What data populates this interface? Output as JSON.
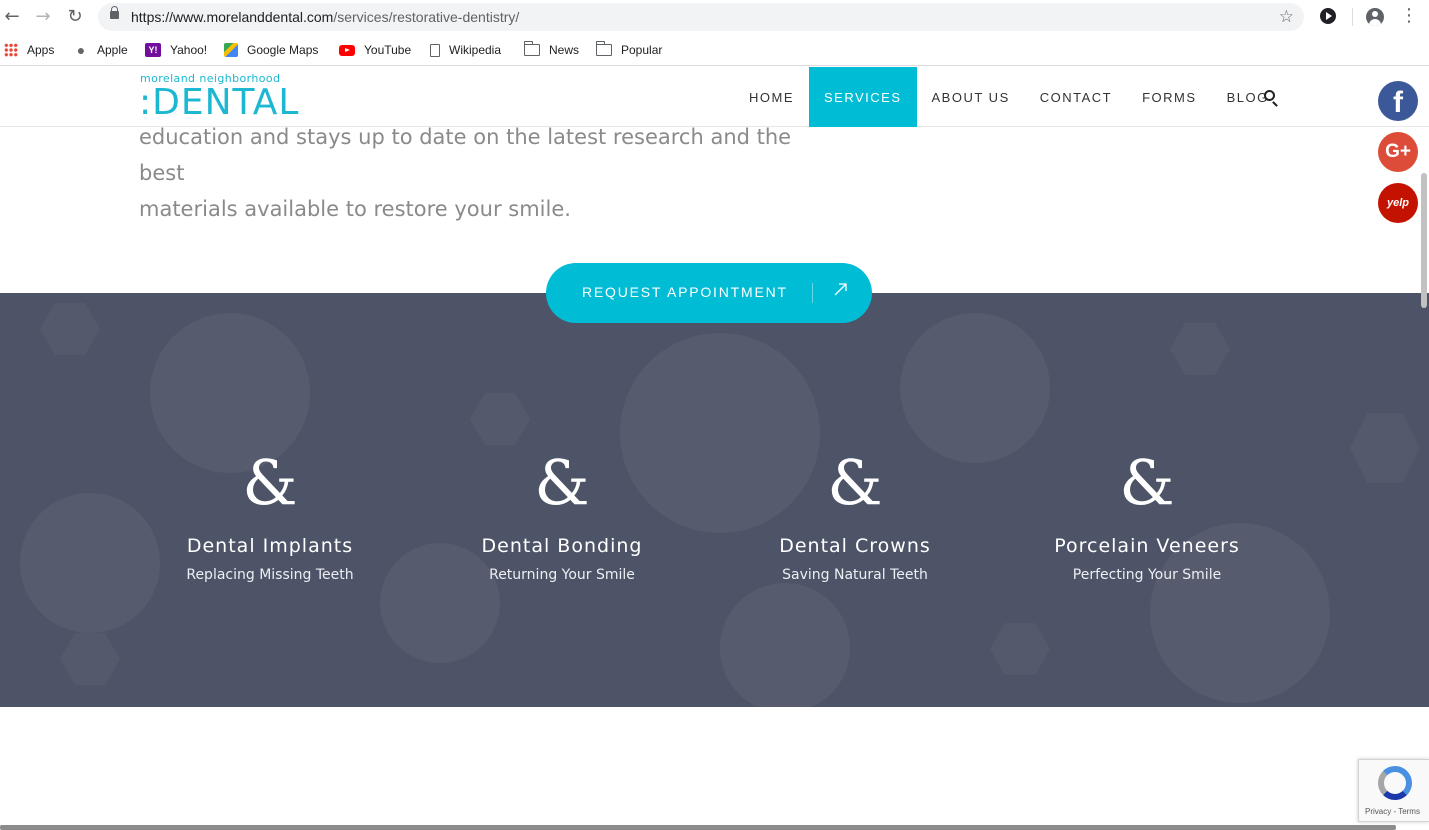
{
  "browser": {
    "url_host": "https://www.morelanddental.com",
    "url_path": "/services/restorative-dentistry/",
    "bookmarks": [
      "Apps",
      "Apple",
      "Yahoo!",
      "Google Maps",
      "YouTube",
      "Wikipedia",
      "News",
      "Popular"
    ]
  },
  "site": {
    "logo_top": "moreland neighborhood",
    "logo_main": ":DENTAL",
    "menu": [
      "HOME",
      "SERVICES",
      "ABOUT US",
      "CONTACT",
      "FORMS",
      "BLOG"
    ],
    "active_menu": "SERVICES",
    "accent_color": "#00bcd4",
    "dark_section_color": "#4d5467"
  },
  "social": {
    "facebook": "f",
    "google_plus": "G+",
    "yelp": "yelp"
  },
  "intro": {
    "line1": "education and stays up to date on the latest research and the best",
    "line2": "materials available to restore your smile."
  },
  "cta": {
    "label": "REQUEST APPOINTMENT"
  },
  "services": [
    {
      "icon": "&",
      "title": "Dental Implants",
      "subtitle": "Replacing Missing Teeth"
    },
    {
      "icon": "&",
      "title": "Dental Bonding",
      "subtitle": "Returning Your Smile"
    },
    {
      "icon": "&",
      "title": "Dental Crowns",
      "subtitle": "Saving Natural Teeth"
    },
    {
      "icon": "&",
      "title": "Porcelain Veneers",
      "subtitle": "Perfecting Your Smile"
    }
  ],
  "recaptcha": {
    "text": "Privacy - Terms"
  }
}
